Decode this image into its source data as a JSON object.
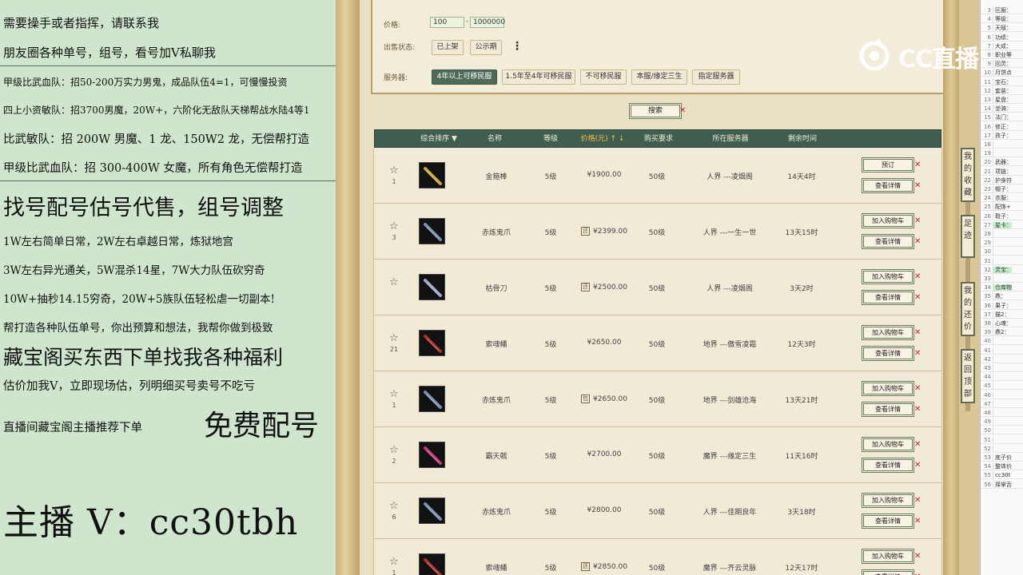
{
  "left_panel": {
    "lines": [
      "需要操手或者指挥，请联系我",
      "朋友圈各种单号，组号，看号加V私聊我",
      "甲级比武血队：招50-200万实力男鬼，成品队伍4=1，可慢慢投资",
      "四上小资敏队：招3700男魔，20W+，六阶化无敌队天梯帮战水陆4等1",
      "比武敏队：招 200W 男魔、1 龙、150W2 龙，无偿帮打造",
      "甲级比武血队：招 300-400W 女魔，所有角色无偿帮打造",
      "找号配号估号代售，组号调整",
      "1W左右简单日常，2W左右卓越日常，炼狱地宫",
      "3W左右异光通关，5W混杀14星，7W大力队伍砍穷奇",
      "10W+抽秒14.15穷奇，20W+5族队伍轻松虐一切副本!",
      "帮打造各种队伍单号，你出预算和想法，我帮你做到极致",
      "藏宝阁买东西下单找我各种福利",
      "估价加我V，立即现场估，列明细买号卖号不吃亏",
      "直播间藏宝阁主播推荐下单",
      "免费配号",
      "主播 V：cc30tbh"
    ]
  },
  "filters": {
    "price_label": "价格:",
    "price_min": "100",
    "price_max": "1000000",
    "price_dash": "-",
    "status_label": "出售状态:",
    "status_options": [
      "已上架",
      "公示期"
    ],
    "more_icon": "⋮",
    "server_label": "服务器:",
    "server_options": [
      "4年以上可移民服",
      "1.5年至4年可移民服",
      "不可移民服",
      "本服/缘定三生",
      "指定服务器"
    ]
  },
  "search_button": "搜索",
  "close_mark": "✕",
  "table": {
    "headers": [
      "综合排序 ▼",
      "名称",
      "等级",
      "价格(元) ↑ ↓",
      "购买要求",
      "所在服务器",
      "剩余时间"
    ],
    "rows": [
      {
        "rank": "1",
        "name": "金箍棒",
        "level": "5级",
        "cert": false,
        "price": "¥1900.00",
        "req": "50级",
        "server": "人界 ---凌烟阁",
        "time": "14天4时",
        "btn1": "预订",
        "btn2": "查看详情",
        "img_color": "#c9a63a"
      },
      {
        "rank": "3",
        "name": "赤炼鬼爪",
        "level": "5级",
        "cert": true,
        "cert_text": "还",
        "price": "¥2399.00",
        "req": "50级",
        "server": "人界 ---一生一世",
        "time": "13天15时",
        "btn1": "加入购物车",
        "btn2": "查看详情",
        "img_color": "#7a8fb0"
      },
      {
        "rank": "",
        "name": "枯骨刀",
        "level": "5级",
        "cert": true,
        "cert_text": "还",
        "price": "¥2500.00",
        "req": "50级",
        "server": "人界 ---凌烟阁",
        "time": "3天2时",
        "btn1": "加入购物车",
        "btn2": "查看详情",
        "img_color": "#9aa7c9"
      },
      {
        "rank": "21",
        "name": "索魂幡",
        "level": "5级",
        "cert": false,
        "price": "¥2650.00",
        "req": "50级",
        "server": "地界 ---傲雪凌霜",
        "time": "12天3时",
        "btn1": "加入购物车",
        "btn2": "查看详情",
        "img_color": "#a8332e"
      },
      {
        "rank": "1",
        "name": "赤炼鬼爪",
        "level": "5级",
        "cert": true,
        "cert_text": "包",
        "price": "¥2650.00",
        "req": "50级",
        "server": "地界 ---剑雄沧海",
        "time": "13天21时",
        "btn1": "加入购物车",
        "btn2": "查看详情",
        "img_color": "#7a8fb0"
      },
      {
        "rank": "2",
        "name": "霸天戟",
        "level": "5级",
        "cert": false,
        "price": "¥2700.00",
        "req": "50级",
        "server": "魔界 ---缘定三生",
        "time": "11天16时",
        "btn1": "加入购物车",
        "btn2": "查看详情",
        "img_color": "#c23b7a"
      },
      {
        "rank": "6",
        "name": "赤炼鬼爪",
        "level": "5级",
        "cert": false,
        "price": "¥2800.00",
        "req": "50级",
        "server": "人界 ---佳期良年",
        "time": "3天18时",
        "btn1": "加入购物车",
        "btn2": "查看详情",
        "img_color": "#7a8fb0"
      },
      {
        "rank": "1",
        "name": "索魂幡",
        "level": "5级",
        "cert": true,
        "cert_text": "还",
        "price": "¥2850.00",
        "req": "50级",
        "server": "魔界 ---齐云灵脉",
        "time": "12天17时",
        "btn1": "加入购物车",
        "btn2": "查看详情",
        "img_color": "#a8332e"
      }
    ]
  },
  "side_tabs": [
    "我的收藏",
    "足迹",
    "我的还价",
    "返回顶部"
  ],
  "sheet_rows": [
    {
      "n": "3",
      "t": "区服："
    },
    {
      "n": "4",
      "t": "等级："
    },
    {
      "n": "5",
      "t": "天赋："
    },
    {
      "n": "6",
      "t": "功绩："
    },
    {
      "n": "7",
      "t": "大成："
    },
    {
      "n": "8",
      "t": "职业等"
    },
    {
      "n": "9",
      "t": "回灵："
    },
    {
      "n": "10",
      "t": "月饼点"
    },
    {
      "n": "11",
      "t": "宝石："
    },
    {
      "n": "12",
      "t": "套装："
    },
    {
      "n": "13",
      "t": "星盘："
    },
    {
      "n": "14",
      "t": "坐骑："
    },
    {
      "n": "15",
      "t": "法门："
    },
    {
      "n": "16",
      "t": "修正："
    },
    {
      "n": "17",
      "t": "孩子："
    },
    {
      "n": "18",
      "t": ""
    },
    {
      "n": "19",
      "t": ""
    },
    {
      "n": "20",
      "t": "武器："
    },
    {
      "n": "21",
      "t": "项链："
    },
    {
      "n": "22",
      "t": "护身符"
    },
    {
      "n": "23",
      "t": "帽子："
    },
    {
      "n": "24",
      "t": "衣服："
    },
    {
      "n": "25",
      "t": "配饰+"
    },
    {
      "n": "26",
      "t": "鞋子："
    },
    {
      "n": "27",
      "t": "星卡：",
      "hl": true
    },
    {
      "n": "28",
      "t": ""
    },
    {
      "n": "29",
      "t": ""
    },
    {
      "n": "30",
      "t": ""
    },
    {
      "n": "31",
      "t": ""
    },
    {
      "n": "32",
      "t": "灵宝：",
      "hl": true
    },
    {
      "n": "33",
      "t": ""
    },
    {
      "n": "34",
      "t": "仓库物",
      "hl": true
    },
    {
      "n": "35",
      "t": "鼎："
    },
    {
      "n": "36",
      "t": "果子："
    },
    {
      "n": "37",
      "t": "猫2："
    },
    {
      "n": "38",
      "t": "心魂："
    },
    {
      "n": "39",
      "t": "鼎2："
    },
    {
      "n": "40",
      "t": ""
    },
    {
      "n": "41",
      "t": ""
    },
    {
      "n": "42",
      "t": ""
    },
    {
      "n": "43",
      "t": ""
    },
    {
      "n": "44",
      "t": ""
    },
    {
      "n": "45",
      "t": ""
    },
    {
      "n": "46",
      "t": ""
    },
    {
      "n": "47",
      "t": ""
    },
    {
      "n": "48",
      "t": ""
    },
    {
      "n": "49",
      "t": ""
    },
    {
      "n": "50",
      "t": ""
    },
    {
      "n": "51",
      "t": ""
    },
    {
      "n": "52",
      "t": ""
    },
    {
      "n": "53",
      "t": "底子价"
    },
    {
      "n": "54",
      "t": "整体价"
    },
    {
      "n": "55",
      "t": "cc30t"
    },
    {
      "n": "56",
      "t": "择掌舌"
    }
  ],
  "watermark": "CC直播"
}
